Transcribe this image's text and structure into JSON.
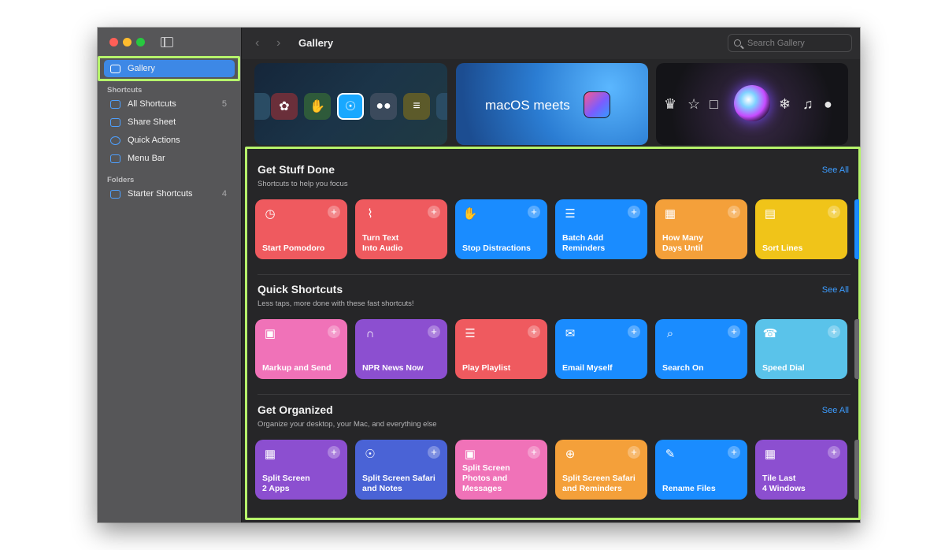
{
  "window": {
    "title": "Gallery"
  },
  "search": {
    "placeholder": "Search Gallery"
  },
  "sidebar": {
    "gallery_label": "Gallery",
    "shortcuts_header": "Shortcuts",
    "items": [
      {
        "label": "All Shortcuts",
        "count": "5"
      },
      {
        "label": "Share Sheet",
        "count": ""
      },
      {
        "label": "Quick Actions",
        "count": ""
      },
      {
        "label": "Menu Bar",
        "count": ""
      }
    ],
    "folders_header": "Folders",
    "folders": [
      {
        "label": "Starter Shortcuts",
        "count": "4"
      }
    ]
  },
  "banners": {
    "macos_text": "macOS meets"
  },
  "sections": [
    {
      "title": "Get Stuff Done",
      "subtitle": "Shortcuts to help you focus",
      "see_all": "See All",
      "cards": [
        {
          "label": "Start Pomodoro",
          "icon": "timer-icon",
          "color": "#ef5a5f"
        },
        {
          "label": "Turn Text\nInto Audio",
          "icon": "waveform-icon",
          "color": "#ef5a5f"
        },
        {
          "label": "Stop Distractions",
          "icon": "hand-icon",
          "color": "#1a8cff"
        },
        {
          "label": "Batch Add\nReminders",
          "icon": "list-icon",
          "color": "#1a8cff"
        },
        {
          "label": "How Many\nDays Until",
          "icon": "calendar-icon",
          "color": "#f4a03a"
        },
        {
          "label": "Sort Lines",
          "icon": "document-icon",
          "color": "#f0c419"
        }
      ]
    },
    {
      "title": "Quick Shortcuts",
      "subtitle": "Less taps, more done with these fast shortcuts!",
      "see_all": "See All",
      "cards": [
        {
          "label": "Markup and Send",
          "icon": "photo-icon",
          "color": "#f072b8"
        },
        {
          "label": "NPR News Now",
          "icon": "headphones-icon",
          "color": "#8c4fd0"
        },
        {
          "label": "Play Playlist",
          "icon": "list-icon",
          "color": "#ef5a5f"
        },
        {
          "label": "Email Myself",
          "icon": "envelope-icon",
          "color": "#1a8cff"
        },
        {
          "label": "Search On",
          "icon": "search-icon",
          "color": "#1a8cff"
        },
        {
          "label": "Speed Dial",
          "icon": "phone-icon",
          "color": "#5ac3ea"
        }
      ]
    },
    {
      "title": "Get Organized",
      "subtitle": "Organize your desktop, your Mac, and everything else",
      "see_all": "See All",
      "cards": [
        {
          "label": "Split Screen\n2 Apps",
          "icon": "grid-icon",
          "color": "#8c4fd0"
        },
        {
          "label": "Split Screen Safari\nand Notes",
          "icon": "compass-icon",
          "color": "#4a63d6"
        },
        {
          "label": "Split Screen\nPhotos and\nMessages",
          "icon": "photo-icon",
          "color": "#f072b8"
        },
        {
          "label": "Split Screen Safari\nand Reminders",
          "icon": "globe-icon",
          "color": "#f4a03a"
        },
        {
          "label": "Rename Files",
          "icon": "pencil-icon",
          "color": "#1a8cff"
        },
        {
          "label": "Tile Last\n4 Windows",
          "icon": "grid-icon",
          "color": "#8c4fd0"
        }
      ]
    }
  ]
}
